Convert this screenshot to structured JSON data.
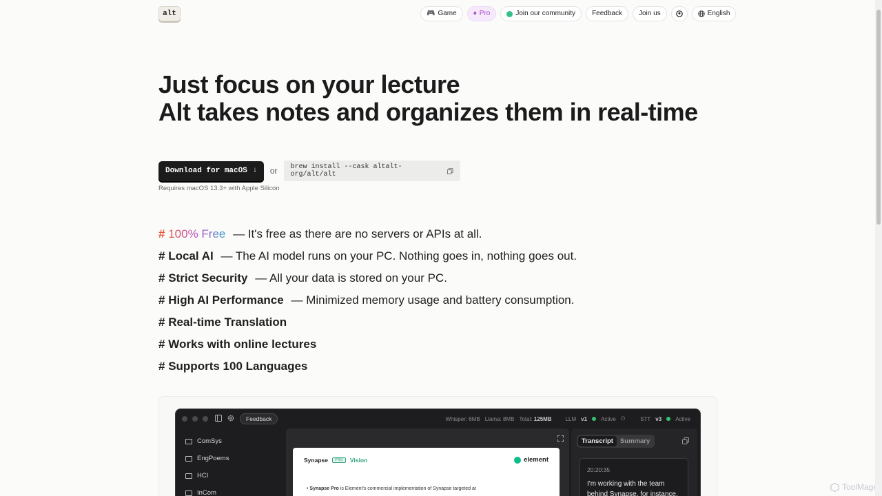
{
  "header": {
    "logo": "alt",
    "nav": [
      {
        "label": "Game",
        "icon": "gamepad-icon"
      },
      {
        "label": "Pro",
        "icon": "gem-icon"
      },
      {
        "label": "Join our community",
        "icon": "community-icon"
      },
      {
        "label": "Feedback"
      },
      {
        "label": "Join us"
      },
      {
        "label": "",
        "icon": "github-icon"
      },
      {
        "label": "English",
        "icon": "globe-icon"
      }
    ]
  },
  "hero": {
    "line1": "Just focus on your lecture",
    "line2": "Alt takes notes and organizes them in real-time"
  },
  "cta": {
    "download_label": "Download for macOS",
    "or": "or",
    "brew_command": "brew install --cask altalt-org/alt/alt",
    "requirement": "Requires macOS 13.3+ with Apple Silicon"
  },
  "features": [
    {
      "hash": "#",
      "title": "100% Free",
      "desc": "— It's free as there are no servers or APIs at all."
    },
    {
      "hash": "#",
      "title": "Local AI",
      "desc": "— The AI model runs on your PC. Nothing goes in, nothing goes out."
    },
    {
      "hash": "#",
      "title": "Strict Security",
      "desc": "— All your data is stored on your PC."
    },
    {
      "hash": "#",
      "title": "High AI Performance",
      "desc": "— Minimized memory usage and battery consumption."
    },
    {
      "hash": "#",
      "title": "Real-time Translation",
      "desc": ""
    },
    {
      "hash": "#",
      "title": "Works with online lectures",
      "desc": ""
    },
    {
      "hash": "#",
      "title": "Supports 100 Languages",
      "desc": ""
    }
  ],
  "app": {
    "feedback": "Feedback",
    "stats": {
      "whisper_label": "Whisper:",
      "whisper_val": "6MB",
      "llama_label": "Llama:",
      "llama_val": "8MB",
      "total_label": "Total:",
      "total_val": "125MB",
      "llm_label": "LLM",
      "llm_ver": "v1",
      "llm_status": "Active",
      "stt_label": "STT",
      "stt_ver": "v3",
      "stt_status": "Active"
    },
    "folders": [
      "ComSys",
      "EngPoems",
      "HCI",
      "InCom"
    ],
    "doc": {
      "title": "Synapse",
      "pro_tag": "PRO",
      "vision": "Vision",
      "brand": "element",
      "bullet_bold": "Synapse Pro",
      "bullet_text": "is Element's commercial implementation of Synapse targeted at"
    },
    "tabs": [
      "Transcript",
      "Summary"
    ],
    "transcript": {
      "time": "20:20:35",
      "text": "I'm working with the team behind Synapse, for instance,"
    }
  },
  "watermark": "ToolMage"
}
